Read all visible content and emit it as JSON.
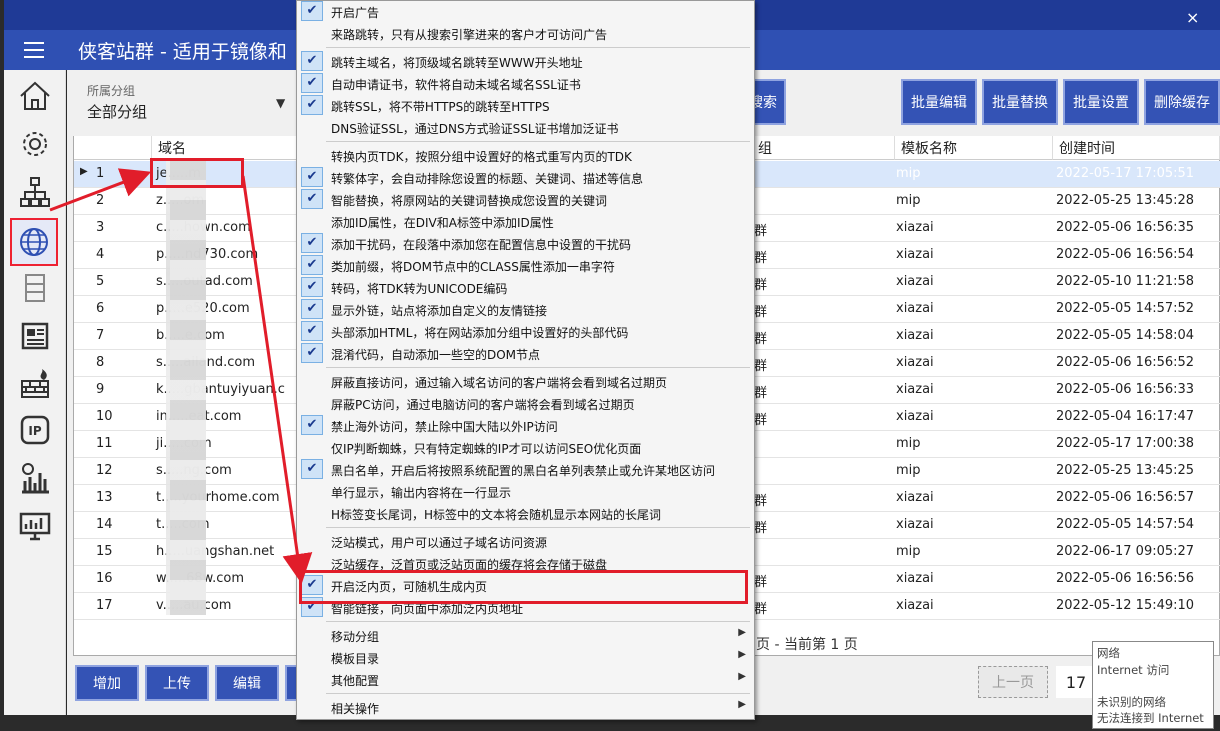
{
  "app": {
    "title": "侠客站群 - 适用于镜像和",
    "close": "×"
  },
  "group": {
    "label": "所属分组",
    "value": "全部分组"
  },
  "toolbar": {
    "search": "搜索",
    "batch_edit": "批量编辑",
    "batch_replace": "批量替换",
    "batch_settings": "批量设置",
    "delete_cache": "删除缓存"
  },
  "table": {
    "headers": {
      "domain": "域名",
      "group": "组",
      "template": "模板名称",
      "created": "创建时间"
    },
    "rows": [
      {
        "n": "1",
        "domain": "je.....m",
        "group": "",
        "template": "mip",
        "created": "2022-05-17 17:05:51"
      },
      {
        "n": "2",
        "domain": "z.....om",
        "group": "",
        "template": "mip",
        "created": "2022-05-25 13:45:28"
      },
      {
        "n": "3",
        "domain": "c.....hown.com",
        "group": "群",
        "template": "xiazai",
        "created": "2022-05-06 16:56:35"
      },
      {
        "n": "4",
        "domain": "p.....nd730.com",
        "group": "群",
        "template": "xiazai",
        "created": "2022-05-06 16:56:54"
      },
      {
        "n": "5",
        "domain": "s.....outad.com",
        "group": "群",
        "template": "xiazai",
        "created": "2022-05-10 11:21:58"
      },
      {
        "n": "6",
        "domain": "p.....e520.com",
        "group": "群",
        "template": "xiazai",
        "created": "2022-05-05 14:57:52"
      },
      {
        "n": "7",
        "domain": "b.....e.com",
        "group": "群",
        "template": "xiazai",
        "created": "2022-05-05 14:58:04"
      },
      {
        "n": "8",
        "domain": "s.....ailand.com",
        "group": "群",
        "template": "xiazai",
        "created": "2022-05-06 16:56:52"
      },
      {
        "n": "9",
        "domain": "k.....gbantuyiyuan.c",
        "group": "群",
        "template": "xiazai",
        "created": "2022-05-06 16:56:33"
      },
      {
        "n": "10",
        "domain": "in.....eat.com",
        "group": "群",
        "template": "xiazai",
        "created": "2022-05-04 16:17:47"
      },
      {
        "n": "11",
        "domain": "ji.....com",
        "group": "",
        "template": "mip",
        "created": "2022-05-17 17:00:38"
      },
      {
        "n": "12",
        "domain": "s.....ng.com",
        "group": "",
        "template": "mip",
        "created": "2022-05-25 13:45:25"
      },
      {
        "n": "13",
        "domain": "t.....yourhome.com",
        "group": "群",
        "template": "xiazai",
        "created": "2022-05-06 16:56:57"
      },
      {
        "n": "14",
        "domain": "t.....com",
        "group": "群",
        "template": "xiazai",
        "created": "2022-05-05 14:57:54"
      },
      {
        "n": "15",
        "domain": "h.....uangshan.net",
        "group": "",
        "template": "mip",
        "created": "2022-06-17 09:05:27"
      },
      {
        "n": "16",
        "domain": "w.....68w.com",
        "group": "群",
        "template": "xiazai",
        "created": "2022-05-06 16:56:56"
      },
      {
        "n": "17",
        "domain": "v.....au.com",
        "group": "群",
        "template": "xiazai",
        "created": "2022-05-12 15:49:10"
      }
    ]
  },
  "bottom": {
    "add": "增加",
    "upload": "上传",
    "edit": "编辑",
    "pager": "页 - 当前第 1 页",
    "prev": "上一页",
    "page_num": "17"
  },
  "tooltip": {
    "l1": "网络",
    "l2": "Internet 访问",
    "l3": "未识别的网络",
    "l4": "无法连接到 Internet"
  },
  "menu": {
    "items": [
      {
        "label": "开启广告",
        "checked": true
      },
      {
        "label": "来路跳转，只有从搜索引擎进来的客户才可访问广告",
        "checked": false
      },
      {
        "label": "跳转主域名，将顶级域名跳转至WWW开头地址",
        "checked": true
      },
      {
        "label": "自动申请证书，软件将自动未域名域名SSL证书",
        "checked": true
      },
      {
        "label": "跳转SSL，将不带HTTPS的跳转至HTTPS",
        "checked": true
      },
      {
        "label": "DNS验证SSL，通过DNS方式验证SSL证书增加泛证书",
        "checked": false
      },
      {
        "label": "转换内页TDK，按照分组中设置好的格式重写内页的TDK",
        "checked": false
      },
      {
        "label": "转繁体字，会自动排除您设置的标题、关键词、描述等信息",
        "checked": true
      },
      {
        "label": "智能替换，将原网站的关键词替换成您设置的关键词",
        "checked": true
      },
      {
        "label": "添加ID属性，在DIV和A标签中添加ID属性",
        "checked": false
      },
      {
        "label": "添加干扰码，在段落中添加您在配置信息中设置的干扰码",
        "checked": true
      },
      {
        "label": "类加前缀，将DOM节点中的CLASS属性添加一串字符",
        "checked": true
      },
      {
        "label": "转码，将TDK转为UNICODE编码",
        "checked": true
      },
      {
        "label": "显示外链，站点将添加自定义的友情链接",
        "checked": true
      },
      {
        "label": "头部添加HTML，将在网站添加分组中设置好的头部代码",
        "checked": true
      },
      {
        "label": "混淆代码，自动添加一些空的DOM节点",
        "checked": true
      },
      {
        "label": "屏蔽直接访问，通过输入域名访问的客户端将会看到域名过期页",
        "checked": false
      },
      {
        "label": "屏蔽PC访问，通过电脑访问的客户端将会看到域名过期页",
        "checked": false
      },
      {
        "label": "禁止海外访问，禁止除中国大陆以外IP访问",
        "checked": true
      },
      {
        "label": "仅IP判断蜘蛛，只有特定蜘蛛的IP才可以访问SEO优化页面",
        "checked": false
      },
      {
        "label": "黑白名单，开启后将按照系统配置的黑白名单列表禁止或允许某地区访问",
        "checked": true
      },
      {
        "label": "单行显示，输出内容将在一行显示",
        "checked": false
      },
      {
        "label": "H标签变长尾词，H标签中的文本将会随机显示本网站的长尾词",
        "checked": false
      },
      {
        "label": "泛站模式，用户可以通过子域名访问资源",
        "checked": false
      },
      {
        "label": "泛站缓存，泛首页或泛站页面的缓存将会存储于磁盘",
        "checked": false
      },
      {
        "label": "开启泛内页，可随机生成内页",
        "checked": true
      },
      {
        "label": "智能链接，向页面中添加泛内页地址",
        "checked": true
      },
      {
        "label": "移动分组",
        "checked": false,
        "sub": true
      },
      {
        "label": "模板目录",
        "checked": false,
        "sub": true
      },
      {
        "label": "其他配置",
        "checked": false,
        "sub": true
      },
      {
        "label": "相关操作",
        "checked": false,
        "sub": true
      }
    ]
  },
  "colors": {
    "accent": "#2f50b3",
    "highlight": "#e11d2a",
    "selection": "#1c79d4"
  }
}
